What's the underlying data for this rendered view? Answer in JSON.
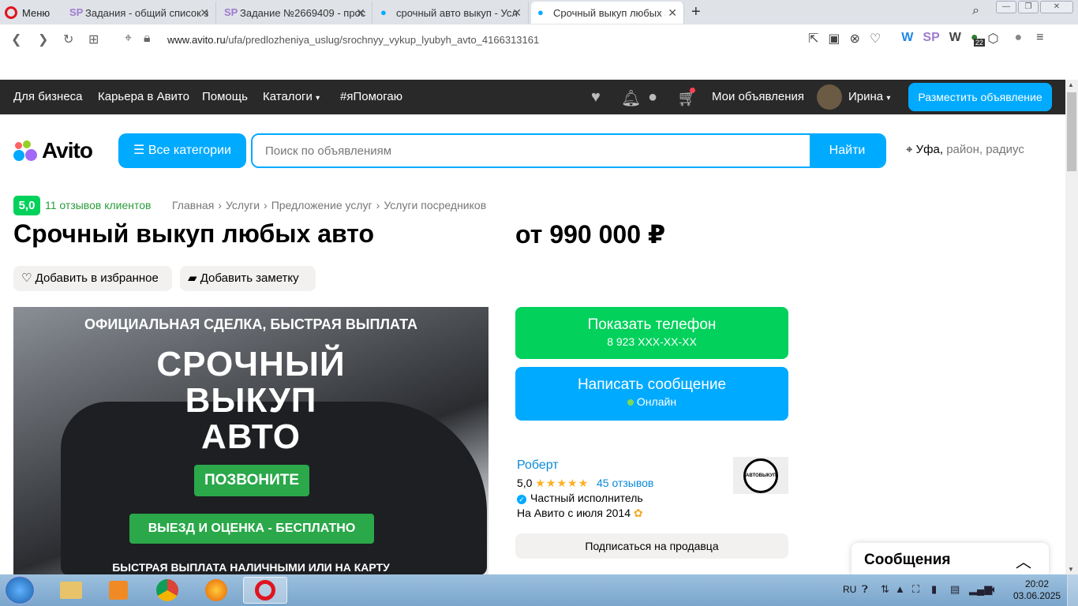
{
  "browser": {
    "menu_label": "Меню",
    "tabs": [
      {
        "label": "Задания - общий список з",
        "icon": "sp-icon"
      },
      {
        "label": "Задание №2669409 - прос",
        "icon": "sp-icon"
      },
      {
        "label": "срочный авто выкуп - Усл",
        "icon": "avito-icon"
      },
      {
        "label": "Срочный выкуп любых ав",
        "icon": "avito-icon",
        "active": true
      }
    ],
    "url_host": "www.avito.ru",
    "url_path": "/ufa/predlozheniya_uslug/srochnyy_vykup_lyubyh_avto_4166313161",
    "extension_badge": "22"
  },
  "topnav": {
    "business": "Для бизнеса",
    "career": "Карьера в Авито",
    "help": "Помощь",
    "catalogs": "Каталоги",
    "pomogayu": "#яПомогаю",
    "my_ads": "Мои объявления",
    "user_name": "Ирина",
    "post_ad": "Разместить объявление"
  },
  "header": {
    "logo_text": "Avito",
    "categories_btn": "Все категории",
    "search_placeholder": "Поиск по объявлениям",
    "search_btn": "Найти",
    "city": "Уфа,",
    "location_sub": "район, радиус"
  },
  "listing": {
    "rating": "5,0",
    "reviews_link": "11 отзывов клиентов",
    "breadcrumbs": [
      "Главная",
      "Услуги",
      "Предложение услуг",
      "Услуги посредников"
    ],
    "title": "Срочный выкуп любых авто",
    "price": "от 990 000 ₽",
    "add_favorite": "Добавить в избранное",
    "add_note": "Добавить заметку",
    "photo_text": {
      "line1": "ОФИЦИАЛЬНАЯ СДЕЛКА, БЫСТРАЯ ВЫПЛАТА",
      "line2": "СРОЧНЫЙ",
      "line3": "ВЫКУП",
      "line4": "АВТО",
      "call": "ПОЗВОНИТЕ",
      "visit": "ВЫЕЗД И ОЦЕНКА - БЕСПЛАТНО",
      "payout": "БЫСТРАЯ ВЫПЛАТА НАЛИЧНЫМИ ИЛИ НА КАРТУ"
    },
    "show_phone": "Показать телефон",
    "phone_masked": "8 923 XXX-XX-XX",
    "write_message": "Написать сообщение",
    "online": "Онлайн"
  },
  "seller": {
    "name": "Роберт",
    "rating": "5,0",
    "stars": "★★★★★",
    "reviews": "45 отзывов",
    "type": "Частный исполнитель",
    "since": "На Авито с июля 2014",
    "logo_text": "АВТОВЫКУП",
    "subscribe": "Подписаться на продавца"
  },
  "messages_panel": {
    "title": "Сообщения"
  },
  "taskbar": {
    "lang": "RU",
    "time": "20:02",
    "date": "03.06.2025"
  },
  "colors": {
    "accent_blue": "#00aaff",
    "accent_green": "#02d15c",
    "nav_dark": "#292929"
  }
}
